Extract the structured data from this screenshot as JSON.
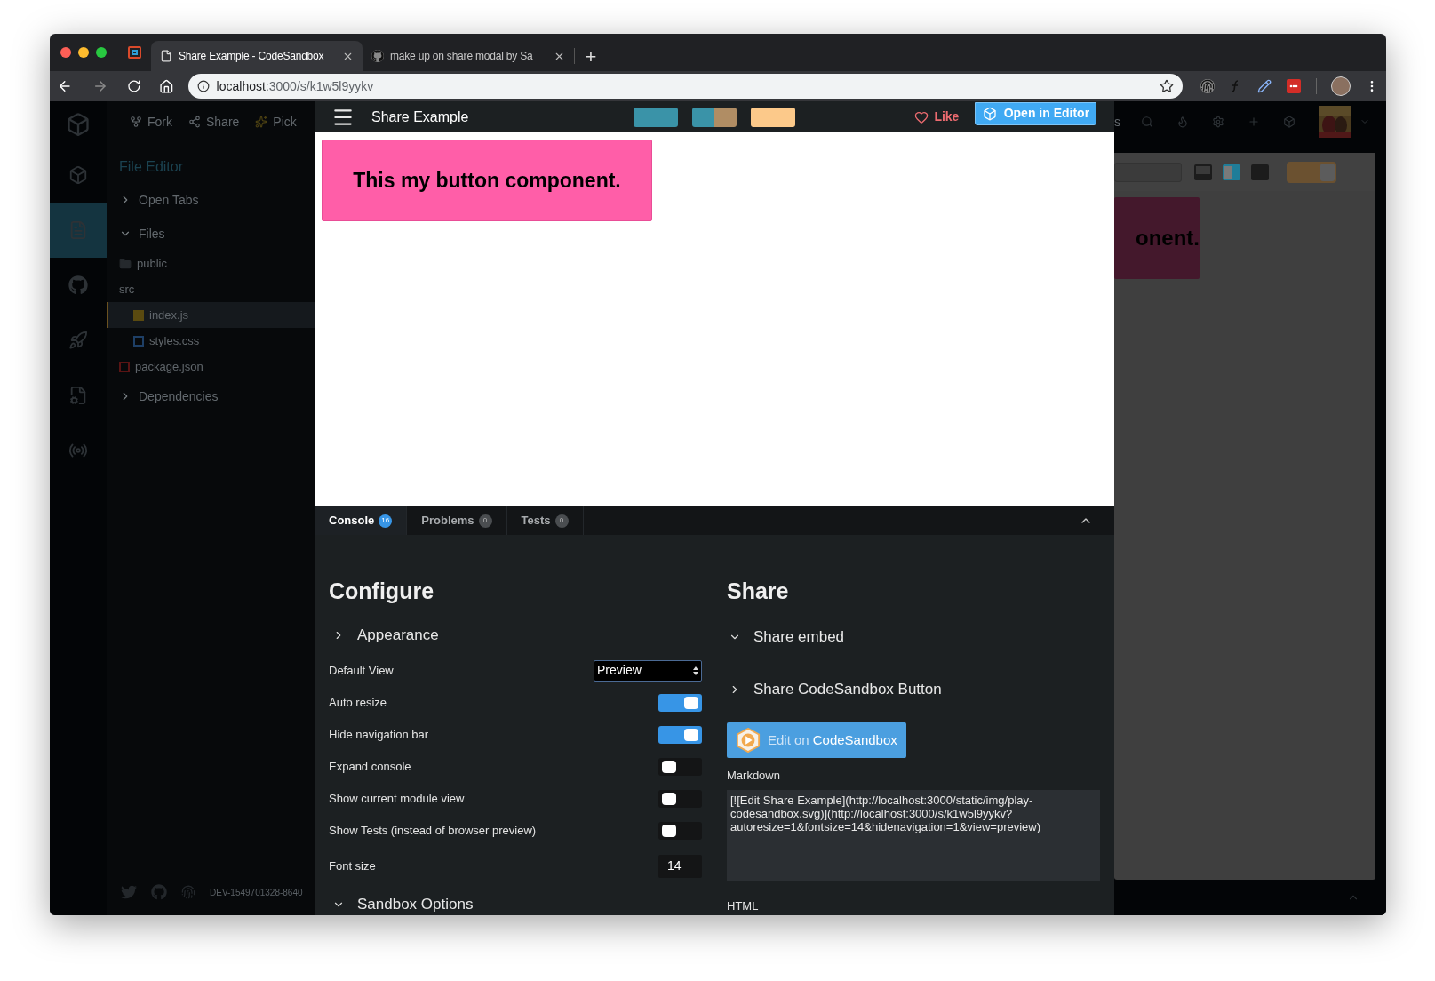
{
  "browser": {
    "tabs": [
      {
        "title": "Share Example - CodeSandbox",
        "selected": true,
        "kind": "page"
      },
      {
        "title": "make up on share modal by Sa",
        "selected": false,
        "kind": "github"
      }
    ],
    "new_tab": "+",
    "address": {
      "host": "localhost",
      "path": ":3000/s/k1w5l9yykv"
    }
  },
  "editor_background": {
    "actions": [
      {
        "label": "Fork",
        "kind": "fork"
      },
      {
        "label": "Share",
        "kind": "share"
      },
      {
        "label": "Pick",
        "kind": "sparkle"
      }
    ],
    "rail": [
      {
        "kind": "cube",
        "selected": false
      },
      {
        "kind": "file",
        "selected": true
      },
      {
        "kind": "github",
        "selected": false
      },
      {
        "kind": "rocket",
        "selected": false
      },
      {
        "kind": "file-gear",
        "selected": false
      },
      {
        "kind": "broadcast",
        "selected": false
      }
    ],
    "panel_title": "File Editor",
    "sections": [
      {
        "label": "Open Tabs",
        "expanded": false
      },
      {
        "label": "Files",
        "expanded": true,
        "children": [
          {
            "name": "public",
            "kind": "folder",
            "selected": false
          },
          {
            "name": "src",
            "selected": false,
            "children": [
              {
                "name": "index.js",
                "kind": "js",
                "selected": true
              },
              {
                "name": "styles.css",
                "kind": "css",
                "selected": false
              }
            ]
          },
          {
            "name": "package.json",
            "kind": "json",
            "selected": false
          }
        ]
      },
      {
        "label": "Dependencies",
        "expanded": false
      }
    ],
    "footer": "DEV-1549701328-8640"
  },
  "modal": {
    "title": "Share Example",
    "layouts": [
      {
        "segments": [
          {
            "color": "#3a93a8"
          }
        ]
      },
      {
        "segments": [
          {
            "color": "#3a93a8"
          },
          {
            "color": "#b08d64"
          }
        ]
      },
      {
        "segments": [
          {
            "color": "#fcc98a"
          }
        ]
      }
    ],
    "like": "Like",
    "open_button": "Open in Editor",
    "preview": {
      "button_text": "This my button component."
    },
    "panel_tabs": [
      {
        "label": "Console",
        "count": "16",
        "selected": true
      },
      {
        "label": "Problems",
        "count": "0",
        "selected": false
      },
      {
        "label": "Tests",
        "count": "0",
        "selected": false
      }
    ],
    "configure": {
      "title": "Configure",
      "appearance": {
        "title": "Appearance",
        "expanded": false
      },
      "options": [
        {
          "kind": "select",
          "label": "Default View",
          "value": "Preview"
        },
        {
          "kind": "toggle",
          "label": "Auto resize",
          "on": true
        },
        {
          "kind": "toggle",
          "label": "Hide navigation bar",
          "on": true
        },
        {
          "kind": "toggle",
          "label": "Expand console",
          "on": false
        },
        {
          "kind": "toggle",
          "label": "Show current module view",
          "on": false
        },
        {
          "kind": "toggle",
          "label": "Show Tests (instead of browser preview)",
          "on": false
        },
        {
          "kind": "number",
          "label": "Font size",
          "value": "14"
        }
      ],
      "sandbox_options": {
        "title": "Sandbox Options",
        "expanded": true
      }
    },
    "share": {
      "title": "Share",
      "sections": [
        {
          "title": "Share embed",
          "expanded": true
        },
        {
          "title": "Share CodeSandbox Button",
          "expanded": false
        }
      ],
      "badge": {
        "text": "Edit on",
        "brand": "CodeSandbox"
      },
      "markdown_label": "Markdown",
      "markdown": "[![Edit Share Example](http://localhost:3000/static/img/play-codesandbox.svg)](http://localhost:3000/s/k1w5l9yykv?autoresize=1&fontsize=14&hidenavigation=1&view=preview)",
      "html_label": "HTML"
    }
  },
  "right_background": {
    "header_fragment": "s",
    "layouts": [
      {
        "kind": "bottom",
        "selected": false
      },
      {
        "kind": "side",
        "selected": true
      },
      {
        "kind": "stack",
        "selected": false
      }
    ],
    "toggle_on": true,
    "preview_text": "onent."
  }
}
